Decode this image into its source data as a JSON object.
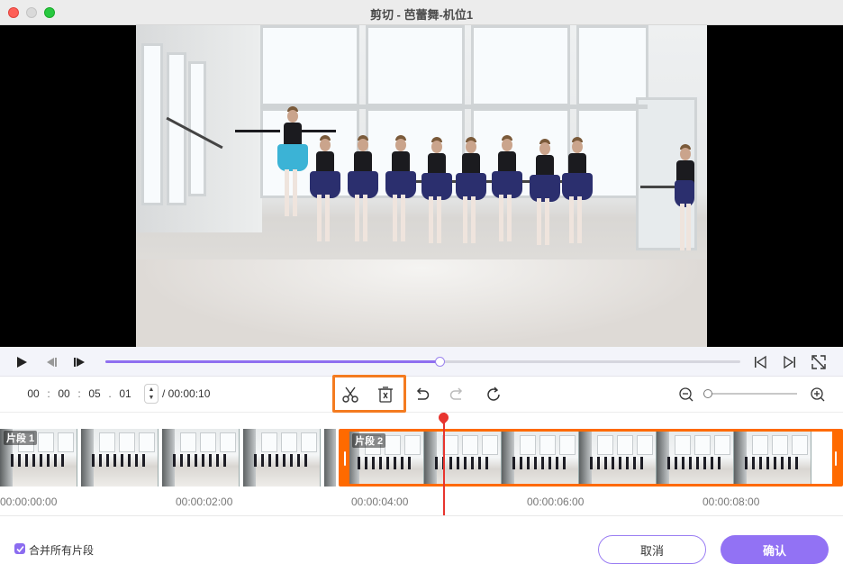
{
  "window": {
    "title": "剪切 - 芭蕾舞-机位1"
  },
  "player": {
    "progress_fraction": 0.526
  },
  "toolbar": {
    "timecode": {
      "hh": "00",
      "mm": "00",
      "ss": "05",
      "ff": "01"
    },
    "total_time": "/ 00:00:10",
    "icons": [
      "scissors-icon",
      "delete-clip-icon",
      "undo-icon",
      "redo-icon",
      "refresh-icon",
      "zoom-out-icon",
      "zoom-in-icon"
    ],
    "zoom_fraction": 0.0
  },
  "timeline": {
    "clips": [
      {
        "label": "片段 1"
      },
      {
        "label": "片段 2"
      }
    ],
    "ruler": [
      "00:00:00:00",
      "00:00:02:00",
      "00:00:04:00",
      "00:00:06:00",
      "00:00:08:00"
    ]
  },
  "footer": {
    "merge_label": "合并所有片段",
    "merge_checked": true,
    "cancel_label": "取消",
    "confirm_label": "确认"
  },
  "colors": {
    "accent": "#9272f4",
    "highlight": "#f47b20",
    "clip_selected": "#ff6a00",
    "playhead": "#e8352f"
  }
}
